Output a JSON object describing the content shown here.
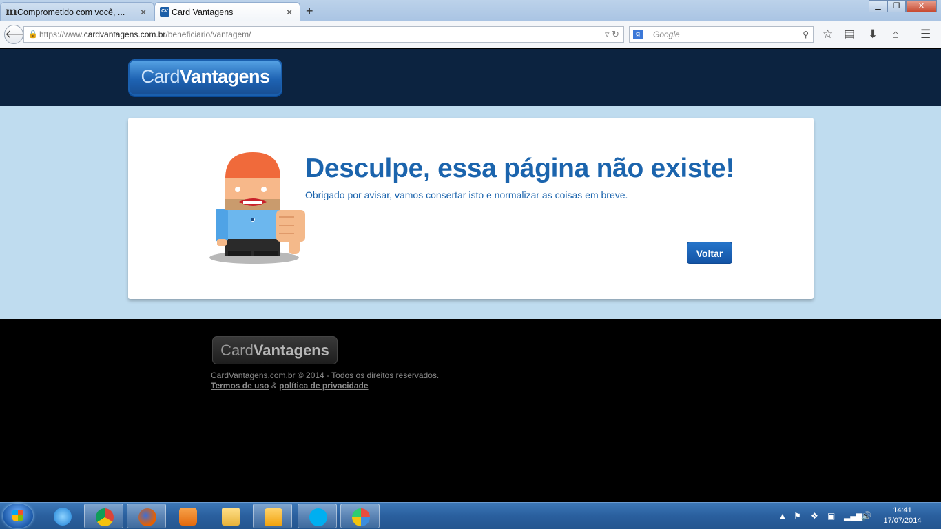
{
  "browser": {
    "tabs": [
      {
        "label": "Comprometido com você, ..."
      },
      {
        "label": "Card Vantagens"
      }
    ],
    "url_prefix": "https://www.",
    "url_domain": "cardvantagens.com.br",
    "url_path": "/beneficiario/vantagem/",
    "search_placeholder": "Google"
  },
  "header": {
    "logo_part1": "Card",
    "logo_part2": "Vantagens"
  },
  "error": {
    "title": "Desculpe, essa página não existe!",
    "message": "Obrigado por avisar, vamos consertar isto e normalizar as coisas em breve.",
    "button_label": "Voltar"
  },
  "footer": {
    "logo_part1": "Card",
    "logo_part2": "Vantagens",
    "copyright": "CardVantagens.com.br © 2014 - Todos os direitos reservados.",
    "terms_link": "Termos de uso",
    "separator": "&",
    "privacy_link": "política de privacidade"
  },
  "taskbar": {
    "time": "14:41",
    "date": "17/07/2014"
  },
  "colors": {
    "header_bg": "#0c2340",
    "content_bg": "#bfdcef",
    "brand_blue": "#1b64ad",
    "button_blue": "#1a5fb4"
  }
}
